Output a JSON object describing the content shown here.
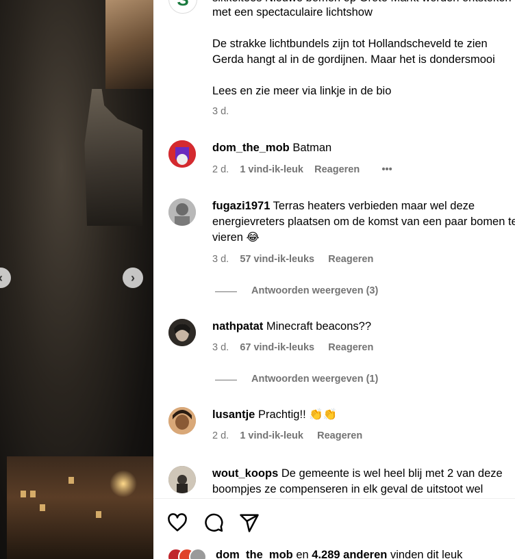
{
  "caption": {
    "line1": "sikkeltees Nieuwe bomen op Grote Markt worden ontstoken",
    "line2": "met een spectaculaire lichtshow",
    "line3": "De strakke lichtbundels zijn tot Hollandscheveld te zien",
    "line4": "Gerda hangt al in de gordijnen. Maar het is dondersmooi",
    "line5": "Lees en zie meer via linkje in de bio",
    "time": "3 d."
  },
  "comments": [
    {
      "user": "dom_the_mob",
      "text": "Batman",
      "time": "2 d.",
      "likes": "1 vind-ik-leuk",
      "reply": "Reageren",
      "more": "•••",
      "avatar_color": "#c0262d"
    },
    {
      "user": "fugazi1971",
      "text": "Terras heaters verbieden maar wel deze",
      "text2": "energievreters plaatsen om de komst van een paar bomen te",
      "text3": "vieren 😂",
      "time": "3 d.",
      "likes": "57 vind-ik-leuks",
      "reply": "Reageren",
      "view_replies": "Antwoorden weergeven (3)",
      "avatar_color": "#9a9a9a"
    },
    {
      "user": "nathpatat",
      "text": "Minecraft beacons??",
      "time": "3 d.",
      "likes": "67 vind-ik-leuks",
      "reply": "Reageren",
      "view_replies": "Antwoorden weergeven (1)",
      "avatar_color": "#3a3530"
    },
    {
      "user": "lusantje",
      "text": "Prachtig!! 👏👏",
      "time": "2 d.",
      "likes": "1 vind-ik-leuk",
      "reply": "Reageren",
      "avatar_color": "#b07a4a"
    },
    {
      "user": "wout_koops",
      "text": "De gemeente is wel heel blij met 2 van deze",
      "text2": "boompjes ze compenseren in elk geval de uitstoot wel",
      "avatar_color": "#6a6258"
    }
  ],
  "likes_summary": {
    "user": "dom_the_mob",
    "mid": " en ",
    "count": "4.289 anderen",
    "tail": " vinden dit leuk"
  },
  "icons": [
    "heart-icon",
    "comment-icon",
    "share-icon",
    "chevron-left-icon",
    "chevron-right-icon"
  ]
}
